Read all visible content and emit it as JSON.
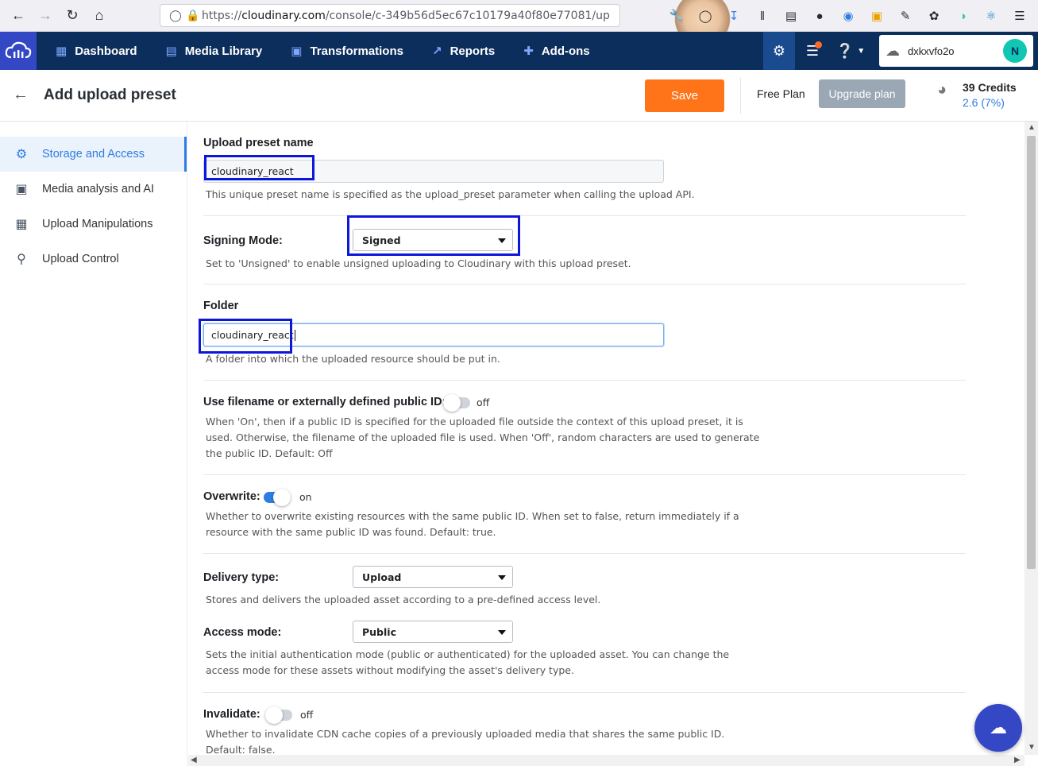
{
  "browser": {
    "url_domain": "cloudinary.com",
    "url_prefix": "https://",
    "url_rest": "/console/c-349b56d5ec67c10179a40f80e77081/up"
  },
  "nav": {
    "items": [
      {
        "label": "Dashboard",
        "icon": "dashboard-icon"
      },
      {
        "label": "Media Library",
        "icon": "media-library-icon"
      },
      {
        "label": "Transformations",
        "icon": "transformations-icon"
      },
      {
        "label": "Reports",
        "icon": "reports-icon"
      },
      {
        "label": "Add-ons",
        "icon": "addons-icon"
      }
    ],
    "account_name": "dxkxvfo2o",
    "account_initial": "N"
  },
  "header": {
    "title": "Add upload preset",
    "save_label": "Save",
    "plan_label": "Free Plan",
    "upgrade_label": "Upgrade plan",
    "credits": "39 Credits",
    "credits_usage": "2.6 (7%)"
  },
  "sidebar": {
    "items": [
      {
        "label": "Storage and Access",
        "icon": "storage-icon",
        "active": true
      },
      {
        "label": "Media analysis and AI",
        "icon": "media-analysis-icon",
        "active": false
      },
      {
        "label": "Upload Manipulations",
        "icon": "upload-manipulations-icon",
        "active": false
      },
      {
        "label": "Upload Control",
        "icon": "key-icon",
        "active": false
      }
    ]
  },
  "form": {
    "preset_name": {
      "label": "Upload preset name",
      "value": "cloudinary_react",
      "help": "This unique preset name is specified as the upload_preset parameter when calling the upload API."
    },
    "signing_mode": {
      "label": "Signing Mode:",
      "value": "Signed",
      "help": "Set to 'Unsigned' to enable unsigned uploading to Cloudinary with this upload preset."
    },
    "folder": {
      "label": "Folder",
      "value": "cloudinary_react",
      "help": "A folder into which the uploaded resource should be put in."
    },
    "use_filename": {
      "label": "Use filename or externally defined public ID:",
      "state": "off",
      "help_lines": [
        "When 'On', then if a public ID is specified for the uploaded file outside the context of this upload preset, it is",
        "used. Otherwise, the filename of the uploaded file is used. When 'Off', random characters are used to generate",
        "the public ID. Default: Off"
      ]
    },
    "overwrite": {
      "label": "Overwrite:",
      "state": "on",
      "help_lines": [
        "Whether to overwrite existing resources with the same public ID. When set to false, return immediately if a",
        "resource with the same public ID was found. Default: true."
      ]
    },
    "delivery_type": {
      "label": "Delivery type:",
      "value": "Upload",
      "help": "Stores and delivers the uploaded asset according to a pre-defined access level."
    },
    "access_mode": {
      "label": "Access mode:",
      "value": "Public",
      "help_lines": [
        "Sets the initial authentication mode (public or authenticated) for the uploaded asset. You can change the",
        "access mode for these assets without modifying the asset's delivery type."
      ]
    },
    "invalidate": {
      "label": "Invalidate:",
      "state": "off",
      "help_lines": [
        "Whether to invalidate CDN cache copies of a previously uploaded media that shares the same public ID.",
        "Default: false."
      ]
    }
  }
}
